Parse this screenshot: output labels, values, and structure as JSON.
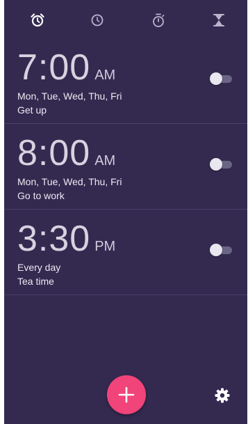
{
  "tabs": [
    {
      "icon": "alarm-clock-icon",
      "selected": true
    },
    {
      "icon": "clock-icon",
      "selected": false
    },
    {
      "icon": "stopwatch-icon",
      "selected": false
    },
    {
      "icon": "hourglass-timer-icon",
      "selected": false
    }
  ],
  "alarms": [
    {
      "time": "7:00",
      "period": "AM",
      "days": "Mon, Tue, Wed, Thu, Fri",
      "label": "Get up",
      "enabled": false
    },
    {
      "time": "8:00",
      "period": "AM",
      "days": "Mon, Tue, Wed, Thu, Fri",
      "label": "Go to work",
      "enabled": false
    },
    {
      "time": "3:30",
      "period": "PM",
      "days": "Every day",
      "label": "Tea time",
      "enabled": false
    }
  ],
  "fab": {
    "icon": "plus-icon"
  },
  "settings": {
    "icon": "gear-icon"
  },
  "colors": {
    "background": "#342a50",
    "fab": "#f0447a",
    "text": "#ebe9f2",
    "divider": "#4b4168"
  }
}
